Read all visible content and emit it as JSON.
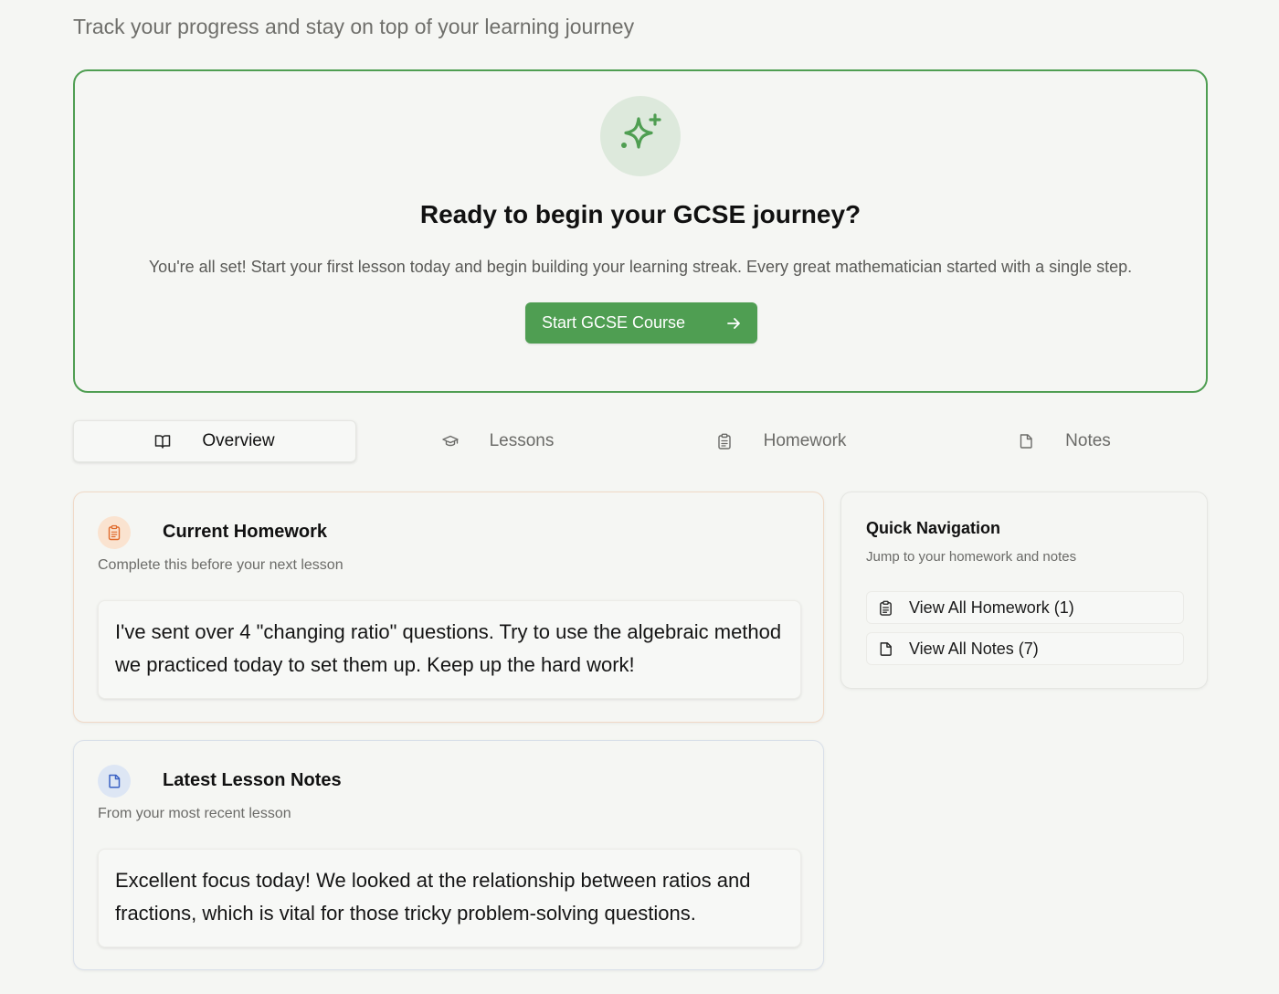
{
  "header": {
    "subtitle": "Track your progress and stay on top of your learning journey"
  },
  "hero": {
    "icon": "sparkles-icon",
    "title": "Ready to begin your GCSE journey?",
    "description": "You're all set! Start your first lesson today and begin building your learning streak. Every great mathematician started with a single step.",
    "button_label": "Start GCSE Course",
    "accent": "#4f9e52"
  },
  "tabs": [
    {
      "label": "Overview",
      "icon": "book-open-icon",
      "active": true
    },
    {
      "label": "Lessons",
      "icon": "graduation-cap-icon",
      "active": false
    },
    {
      "label": "Homework",
      "icon": "clipboard-icon",
      "active": false
    },
    {
      "label": "Notes",
      "icon": "file-icon",
      "active": false
    }
  ],
  "homework_card": {
    "icon": "clipboard-icon",
    "title": "Current Homework",
    "subtitle": "Complete this before your next lesson",
    "body": "I've sent over 4 \"changing ratio\" questions. Try to use the algebraic method we practiced today to set them up. Keep up the hard work!"
  },
  "notes_card": {
    "icon": "file-icon",
    "title": "Latest Lesson Notes",
    "subtitle": "From your most recent lesson",
    "body": "Excellent focus today! We looked at the relationship between ratios and fractions, which is vital for those tricky problem-solving questions."
  },
  "quick_nav": {
    "title": "Quick Navigation",
    "subtitle": "Jump to your homework and notes",
    "links": [
      {
        "label": "View All Homework (1)",
        "icon": "clipboard-icon"
      },
      {
        "label": "View All Notes (7)",
        "icon": "file-icon"
      }
    ]
  }
}
